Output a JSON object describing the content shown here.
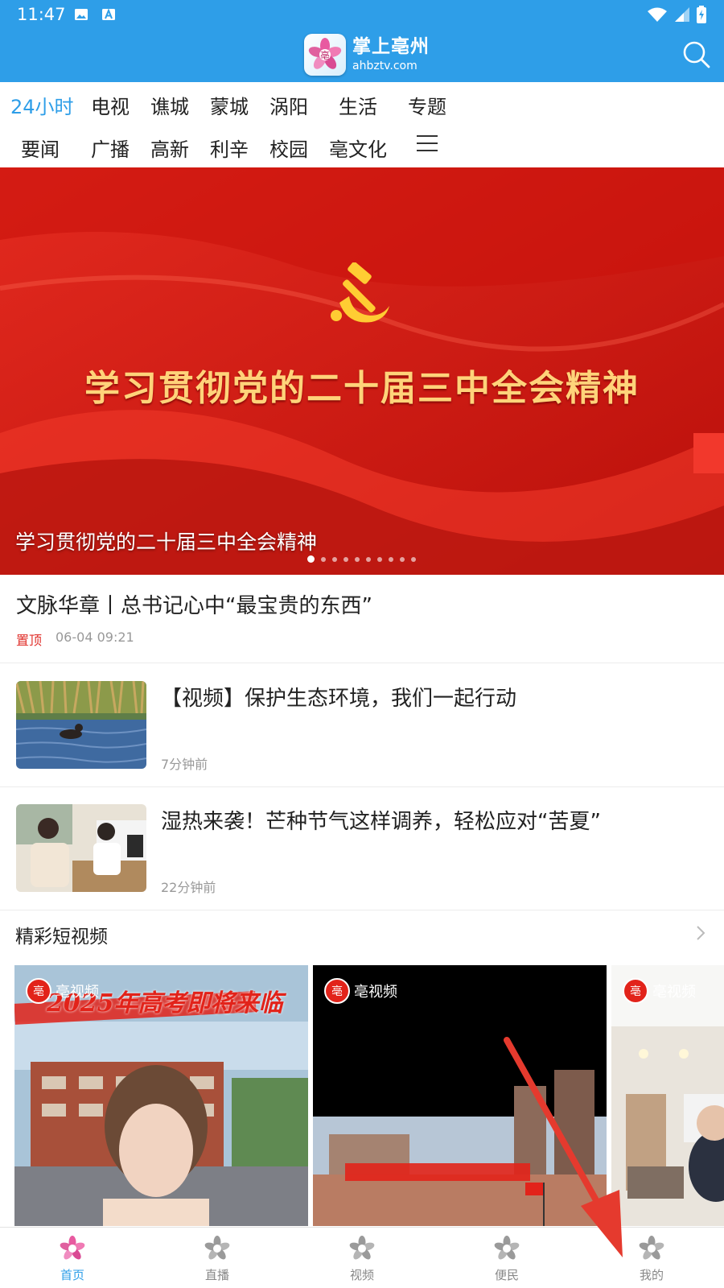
{
  "status_bar": {
    "time": "11:47"
  },
  "header": {
    "logo_title": "掌上亳州",
    "logo_domain": "ahbztv.com",
    "search_icon": "search-icon"
  },
  "tabs": {
    "row1": [
      "24小时",
      "电视",
      "谯城",
      "蒙城",
      "涡阳",
      "生活",
      "专题"
    ],
    "row2": [
      "要闻",
      "广播",
      "高新",
      "利辛",
      "校园",
      "亳文化"
    ],
    "active": "24小时",
    "menu_icon": "menu-icon"
  },
  "banner": {
    "headline": "学习贯彻党的二十届三中全会精神",
    "caption": "学习贯彻党的二十届三中全会精神",
    "dot_count": 10,
    "active_dot": 1,
    "colors": {
      "red": "#d81b14",
      "gold": "#ffd37a"
    }
  },
  "pinned": {
    "title": "文脉华章丨总书记心中“最宝贵的东西”",
    "tag": "置顶",
    "time": "06-04 09:21"
  },
  "news": [
    {
      "title": "【视频】保护生态环境，我们一起行动",
      "time": "7分钟前"
    },
    {
      "title": "湿热来袭！芒种节气这样调养，轻松应对“苦夏”",
      "time": "22分钟前"
    }
  ],
  "short_videos": {
    "title": "精彩短视频",
    "brand": "亳视频",
    "cards": [
      {
        "brand": "亳视频",
        "overlay": "2025年高考即将来临"
      },
      {
        "brand": "亳视频"
      },
      {
        "brand": "亳视频"
      }
    ]
  },
  "bottom_nav": {
    "items": [
      "首页",
      "直播",
      "视频",
      "便民",
      "我的"
    ],
    "active": "首页"
  },
  "theme": {
    "accent": "#2e9ee8",
    "red": "#e0302b"
  }
}
